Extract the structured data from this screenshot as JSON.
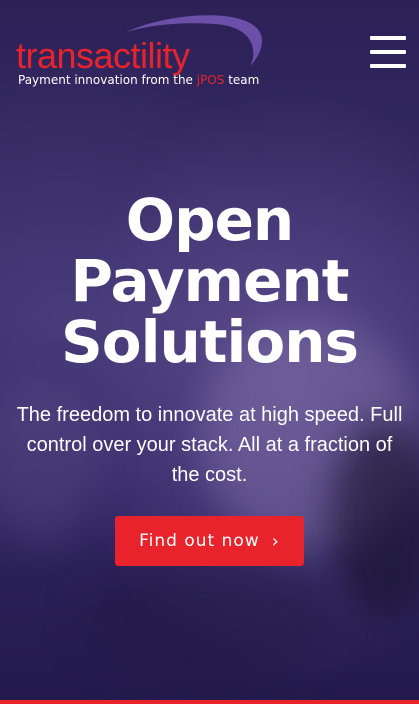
{
  "header": {
    "logo_word": "transactility",
    "tagline_prefix": "Payment innovation from the ",
    "tagline_accent": "jPOS",
    "tagline_suffix": " team",
    "menu_icon": "hamburger-menu-icon"
  },
  "hero": {
    "headline_line1": "Open",
    "headline_line2": "Payment",
    "headline_line3": "Solutions",
    "subtext": "The freedom to innovate at high speed. Full control over your stack. All at a fraction of the cost.",
    "cta_label": "Find out now",
    "cta_icon": "chevron-right-icon",
    "cta_chevron": "›"
  },
  "colors": {
    "brand_red": "#e8232b",
    "brand_purple": "#6b4fa8",
    "background": "#2b2157"
  }
}
